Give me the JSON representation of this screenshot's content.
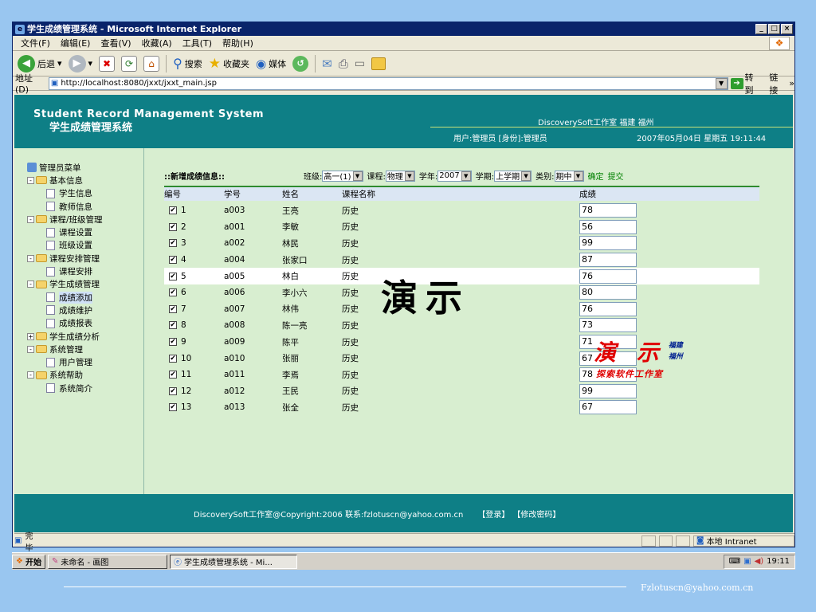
{
  "window": {
    "title": "学生成绩管理系统 - Microsoft Internet Explorer"
  },
  "menu": [
    "文件(F)",
    "编辑(E)",
    "查看(V)",
    "收藏(A)",
    "工具(T)",
    "帮助(H)"
  ],
  "toolbar": {
    "back": "后退",
    "search": "搜索",
    "favorites": "收藏夹",
    "media": "媒体"
  },
  "address": {
    "label": "地址(D)",
    "url": "http://localhost:8080/jxxt/jxxt_main.jsp",
    "go": "转到",
    "links": "链接"
  },
  "header": {
    "title_en": "Student Record Management System",
    "title_cn": "学生成绩管理系统",
    "studio": "DiscoverySoft工作室 福建 福州",
    "user": "用户:管理员 [身份]:管理员",
    "datetime": "2007年05月04日 星期五 19:11:44"
  },
  "sidebar": {
    "root": "管理员菜单",
    "items": [
      {
        "label": "基本信息",
        "type": "folder",
        "sign": "-"
      },
      {
        "label": "学生信息",
        "type": "page"
      },
      {
        "label": "教师信息",
        "type": "page"
      },
      {
        "label": "课程/班级管理",
        "type": "folder",
        "sign": "-"
      },
      {
        "label": "课程设置",
        "type": "page"
      },
      {
        "label": "班级设置",
        "type": "page"
      },
      {
        "label": "课程安排管理",
        "type": "folder",
        "sign": "-"
      },
      {
        "label": "课程安排",
        "type": "page"
      },
      {
        "label": "学生成绩管理",
        "type": "folder",
        "sign": "-"
      },
      {
        "label": "成绩添加",
        "type": "page",
        "selected": true
      },
      {
        "label": "成绩维护",
        "type": "page"
      },
      {
        "label": "成绩报表",
        "type": "page"
      },
      {
        "label": "学生成绩分析",
        "type": "folder",
        "sign": "+"
      },
      {
        "label": "系统管理",
        "type": "folder",
        "sign": "-"
      },
      {
        "label": "用户管理",
        "type": "page"
      },
      {
        "label": "系统帮助",
        "type": "folder",
        "sign": "-"
      },
      {
        "label": "系统简介",
        "type": "page"
      }
    ]
  },
  "form": {
    "title": "::新增成绩信息::",
    "class_label": "班级:",
    "class_value": "高一(1)",
    "course_label": "课程:",
    "course_value": "物理",
    "year_label": "学年:",
    "year_value": "2007",
    "term_label": "学期:",
    "term_value": "上学期",
    "type_label": "类别:",
    "type_value": "期中",
    "confirm": "确定",
    "submit": "提交"
  },
  "table": {
    "headers": [
      "编号",
      "学号",
      "姓名",
      "课程名称",
      "成绩"
    ],
    "rows": [
      {
        "no": "1",
        "id": "a003",
        "name": "王亮",
        "course": "历史",
        "score": "78"
      },
      {
        "no": "2",
        "id": "a001",
        "name": "李敏",
        "course": "历史",
        "score": "56"
      },
      {
        "no": "3",
        "id": "a002",
        "name": "林民",
        "course": "历史",
        "score": "99"
      },
      {
        "no": "4",
        "id": "a004",
        "name": "张家口",
        "course": "历史",
        "score": "87"
      },
      {
        "no": "5",
        "id": "a005",
        "name": "林白",
        "course": "历史",
        "score": "76"
      },
      {
        "no": "6",
        "id": "a006",
        "name": "李小六",
        "course": "历史",
        "score": "80"
      },
      {
        "no": "7",
        "id": "a007",
        "name": "林伟",
        "course": "历史",
        "score": "76"
      },
      {
        "no": "8",
        "id": "a008",
        "name": "陈一亮",
        "course": "历史",
        "score": "73"
      },
      {
        "no": "9",
        "id": "a009",
        "name": "陈平",
        "course": "历史",
        "score": "71"
      },
      {
        "no": "10",
        "id": "a010",
        "name": "张丽",
        "course": "历史",
        "score": "67"
      },
      {
        "no": "11",
        "id": "a011",
        "name": "李焉",
        "course": "历史",
        "score": "78"
      },
      {
        "no": "12",
        "id": "a012",
        "name": "王民",
        "course": "历史",
        "score": "99"
      },
      {
        "no": "13",
        "id": "a013",
        "name": "张全",
        "course": "历史",
        "score": "67"
      }
    ]
  },
  "footer": {
    "copyright": "DiscoverySoft工作室@Copyright:2006 联系:fzlotuscn@yahoo.com.cn",
    "login": "【登录】",
    "change_pwd": "【修改密码】"
  },
  "status": {
    "text": "完毕",
    "zone": "本地 Intranet"
  },
  "taskbar": {
    "start": "开始",
    "task1": "未命名 - 画图",
    "task2": "学生成绩管理系统 - Mi...",
    "time": "19:11"
  },
  "overlay": {
    "demo_big": "演示",
    "demo_red": "演 示",
    "demo_blue_1": "福建",
    "demo_blue_2": "福州",
    "demo_sub": "探索软件工作室"
  },
  "slide_email": "Fzlotuscn@yahoo.com.cn"
}
